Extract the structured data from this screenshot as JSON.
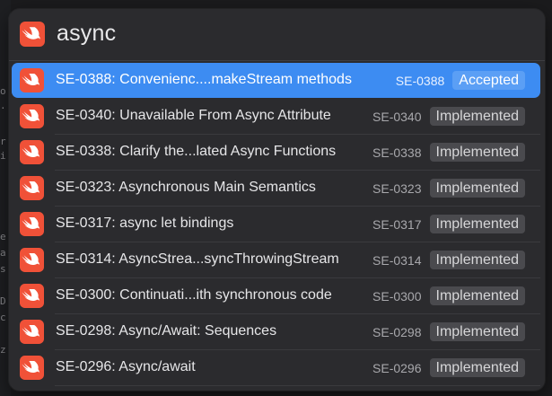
{
  "search": {
    "query": "async",
    "app_icon": "swift-icon"
  },
  "results": [
    {
      "title": "SE-0388: Convenienc....makeStream methods",
      "code": "SE-0388",
      "status": "Accepted",
      "selected": true
    },
    {
      "title": "SE-0340: Unavailable From Async Attribute",
      "code": "SE-0340",
      "status": "Implemented",
      "selected": false
    },
    {
      "title": "SE-0338: Clarify the...lated Async Functions",
      "code": "SE-0338",
      "status": "Implemented",
      "selected": false
    },
    {
      "title": "SE-0323: Asynchronous Main Semantics",
      "code": "SE-0323",
      "status": "Implemented",
      "selected": false
    },
    {
      "title": "SE-0317: async let bindings",
      "code": "SE-0317",
      "status": "Implemented",
      "selected": false
    },
    {
      "title": "SE-0314: AsyncStrea...syncThrowingStream",
      "code": "SE-0314",
      "status": "Implemented",
      "selected": false
    },
    {
      "title": "SE-0300: Continuati...ith synchronous code",
      "code": "SE-0300",
      "status": "Implemented",
      "selected": false
    },
    {
      "title": "SE-0298: Async/Await: Sequences",
      "code": "SE-0298",
      "status": "Implemented",
      "selected": false
    },
    {
      "title": "SE-0296: Async/await",
      "code": "SE-0296",
      "status": "Implemented",
      "selected": false
    }
  ],
  "background_glyphs": [
    "o",
    ".",
    "r",
    "i",
    "e",
    "a",
    "s",
    "D",
    "c",
    "z"
  ],
  "colors": {
    "selection": "#3d8cf2",
    "swift_orange": "#f05138",
    "badge_bg": "#4a4a4e"
  }
}
